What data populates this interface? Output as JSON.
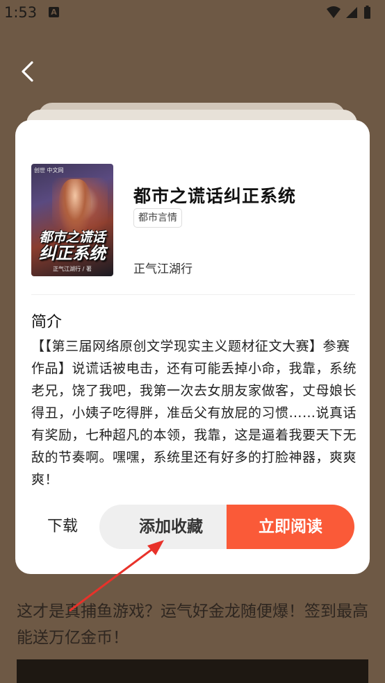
{
  "status_bar": {
    "time": "1:53",
    "notification_icon": "a-badge-icon",
    "wifi_icon": "wifi-icon",
    "signal_icon": "cellular-signal-icon",
    "battery_icon": "battery-icon"
  },
  "nav": {
    "back_icon": "back-chevron-icon"
  },
  "book": {
    "cover_logo": "创世 中文网",
    "cover_title_line1": "都市之谎话",
    "cover_title_line2": "纠正系统",
    "cover_author": "正气江湖行 / 著",
    "title": "都市之谎话纠正系统",
    "category": "都市言情",
    "author": "正气江湖行"
  },
  "intro": {
    "heading": "简介",
    "text": "【【第三届网络原创文学现实主义题材征文大赛】参赛作品】说谎话被电击，还有可能丢掉小命，我靠，系统老兄，饶了我吧，我第一次去女朋友家做客，丈母娘长得丑，小姨子吃得胖，准岳父有放屁的习惯……说真话有奖励，七种超凡的本领，我靠，这是逼着我要天下无敌的节奏啊。嘿嘿，系统里还有好多的打脸神器，爽爽爽！"
  },
  "actions": {
    "download_label": "下载",
    "favorite_label": "添加收藏",
    "read_label": "立即阅读"
  },
  "background": {
    "ad_text": "这才是真捕鱼游戏？运气好金龙随便爆！签到最高能送万亿金币！"
  },
  "colors": {
    "overlay_bg": "#6e5945",
    "read_button": "#fa5a38",
    "favorite_button": "#efefef",
    "annotation_arrow": "#e8322a"
  }
}
